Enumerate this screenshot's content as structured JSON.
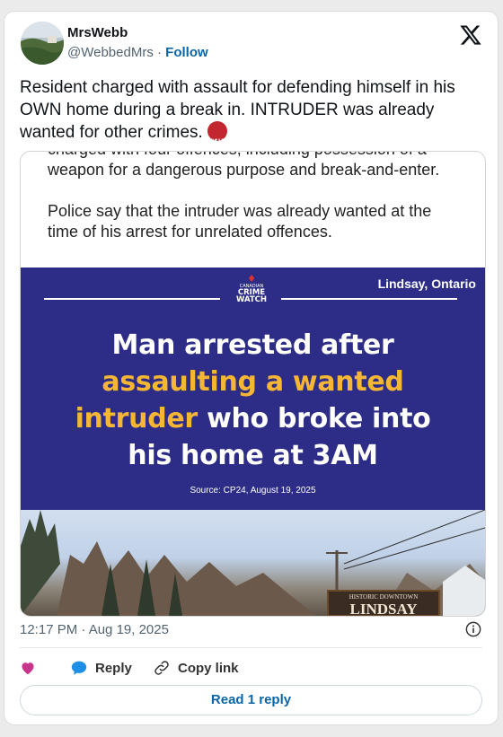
{
  "author": {
    "name": "MrsWebb",
    "handle": "@WebbedMrs",
    "separator": "·",
    "follow_label": "Follow"
  },
  "tweet": {
    "text": "Resident charged with assault for defending himself in his OWN home during a break in. INTRUDER was already wanted for other crimes."
  },
  "emoji": {
    "label": "#$!&",
    "color": "#c2262e"
  },
  "article": {
    "paragraph1": "charged with four offences, including possession of a weapon for a dangerous purpose and break-and-enter.",
    "paragraph2": "Police say that the intruder was already wanted at the time of his arrest for unrelated offences."
  },
  "graphic": {
    "location": "Lindsay, Ontario",
    "logo_top": "CANADIAN",
    "logo_main1": "CRIME",
    "logo_main2": "WATCH",
    "headline_line1": "Man arrested after",
    "headline_line2": "assaulting a wanted",
    "headline_line3a": "intruder",
    "headline_line3b": " who broke into",
    "headline_line4": "his home at 3AM",
    "source": "Source: CP24, August 19, 2025",
    "sign_small": "HISTORIC DOWNTOWN",
    "sign_big": "LINDSAY",
    "colors": {
      "banner": "#2d2d88",
      "highlight": "#f5b633"
    }
  },
  "meta": {
    "timestamp": "12:17 PM · Aug 19, 2025"
  },
  "actions": {
    "reply_label": "Reply",
    "copy_link_label": "Copy link",
    "read_reply_label": "Read 1 reply"
  },
  "icons": {
    "like": "heart-icon",
    "reply": "speech-bubble-icon",
    "copy": "link-icon",
    "info": "info-icon",
    "brand": "x-logo-icon"
  }
}
